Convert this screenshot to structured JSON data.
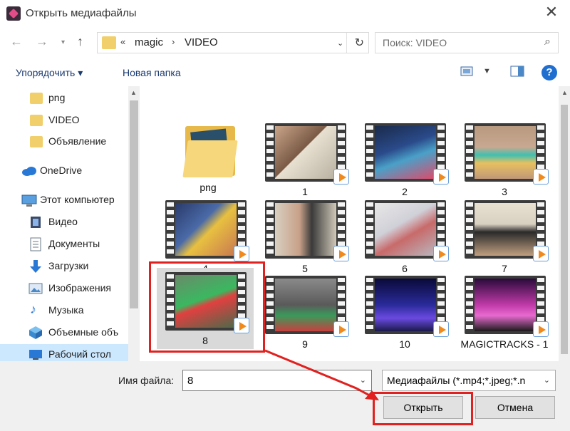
{
  "window": {
    "title": "Открыть медиафайлы",
    "close_label": "✕"
  },
  "address": {
    "overflow": "«",
    "crumbs": [
      "magic",
      "VIDEO"
    ],
    "separator": "›"
  },
  "search": {
    "placeholder": "Поиск: VIDEO"
  },
  "toolbar": {
    "organize": "Упорядочить ▾",
    "new_folder": "Новая папка",
    "help": "?"
  },
  "sidebar": {
    "items": [
      {
        "label": "png",
        "icon": "folder-icon"
      },
      {
        "label": "VIDEO",
        "icon": "folder-icon"
      },
      {
        "label": "Объявление",
        "icon": "folder-icon"
      },
      {
        "label": "OneDrive",
        "icon": "cloud-icon"
      },
      {
        "label": "Этот компьютер",
        "icon": "computer-icon"
      },
      {
        "label": "Видео",
        "icon": "video-icon"
      },
      {
        "label": "Документы",
        "icon": "documents-icon"
      },
      {
        "label": "Загрузки",
        "icon": "download-icon"
      },
      {
        "label": "Изображения",
        "icon": "pictures-icon"
      },
      {
        "label": "Музыка",
        "icon": "music-icon"
      },
      {
        "label": "Объемные объ",
        "icon": "3d-objects-icon"
      },
      {
        "label": "Рабочий стол",
        "icon": "desktop-icon"
      }
    ]
  },
  "files": [
    {
      "name": "png",
      "type": "folder"
    },
    {
      "name": "1",
      "type": "video"
    },
    {
      "name": "2",
      "type": "video"
    },
    {
      "name": "3",
      "type": "video"
    },
    {
      "name": "4",
      "type": "video"
    },
    {
      "name": "5",
      "type": "video"
    },
    {
      "name": "6",
      "type": "video"
    },
    {
      "name": "7",
      "type": "video"
    },
    {
      "name": "8",
      "type": "video",
      "selected": true
    },
    {
      "name": "9",
      "type": "video"
    },
    {
      "name": "10",
      "type": "video"
    },
    {
      "name": "MAGICTRACKS - 1",
      "type": "video"
    }
  ],
  "footer": {
    "filename_label": "Имя файла:",
    "filename_value": "8",
    "filter_value": "Медиафайлы (*.mp4;*.jpeg;*.n",
    "open_button": "Открыть",
    "cancel_button": "Отмена"
  },
  "colors": {
    "accent": "#1f6fd1",
    "highlight": "#e0211f",
    "selection": "#cce8ff"
  }
}
